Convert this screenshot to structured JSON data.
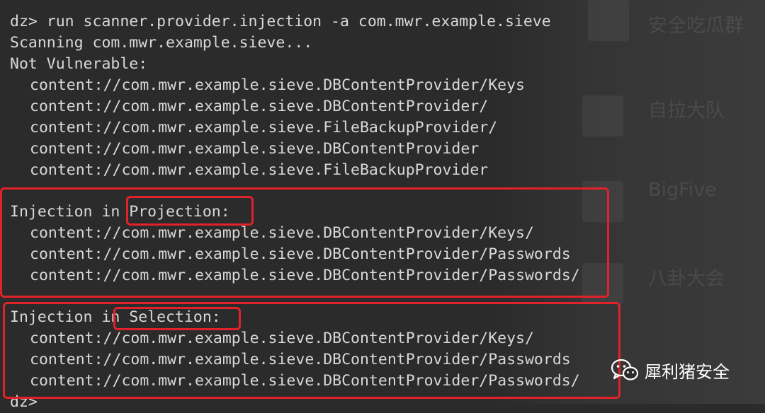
{
  "background_overlay": {
    "items": [
      {
        "label": "安全吃瓜群"
      },
      {
        "label": "自拉大队"
      },
      {
        "label": "BigFive"
      },
      {
        "label": "八卦大会"
      }
    ]
  },
  "terminal": {
    "command_line": "dz> run scanner.provider.injection -a com.mwr.example.sieve",
    "scanning_line": "Scanning com.mwr.example.sieve...",
    "not_vulnerable": {
      "heading": "Not Vulnerable:",
      "items": [
        "content://com.mwr.example.sieve.DBContentProvider/Keys",
        "content://com.mwr.example.sieve.DBContentProvider/",
        "content://com.mwr.example.sieve.FileBackupProvider/",
        "content://com.mwr.example.sieve.DBContentProvider",
        "content://com.mwr.example.sieve.FileBackupProvider"
      ]
    },
    "projection": {
      "heading_prefix": "Injection in ",
      "heading_keyword": "Projection:",
      "items": [
        "content://com.mwr.example.sieve.DBContentProvider/Keys/",
        "content://com.mwr.example.sieve.DBContentProvider/Passwords",
        "content://com.mwr.example.sieve.DBContentProvider/Passwords/"
      ]
    },
    "selection": {
      "heading_prefix": "Injection in ",
      "heading_keyword": "Selection:",
      "items": [
        "content://com.mwr.example.sieve.DBContentProvider/Keys/",
        "content://com.mwr.example.sieve.DBContentProvider/Passwords",
        "content://com.mwr.example.sieve.DBContentProvider/Passwords/"
      ]
    },
    "prompt": "dz>"
  },
  "watermark": {
    "icon": "wechat-icon",
    "text": "犀利猪安全"
  },
  "colors": {
    "background": "#2b2b2b",
    "text": "#d8d8d8",
    "highlight_box": "#e0222a"
  }
}
